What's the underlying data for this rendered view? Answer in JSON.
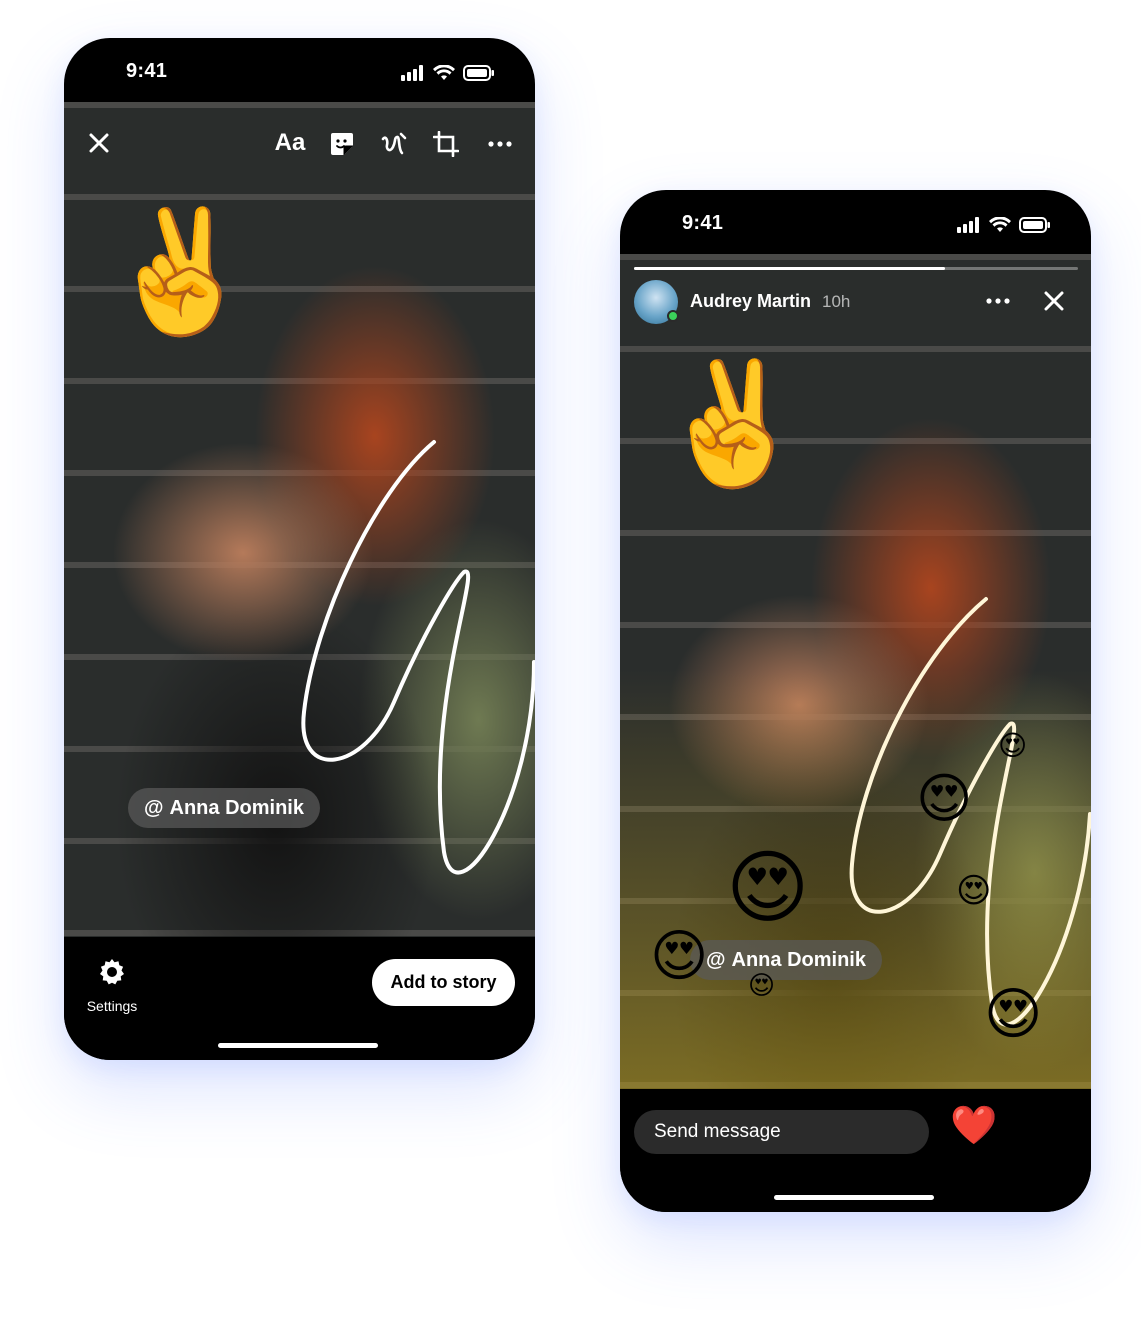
{
  "left_phone": {
    "status": {
      "time": "9:41"
    },
    "toolbar": {
      "close_icon": "close-icon",
      "text_label": "Aa",
      "sticker_icon": "sticker-icon",
      "draw_icon": "scribble-icon",
      "crop_icon": "crop-icon",
      "more_icon": "more-horizontal-icon"
    },
    "stickers": {
      "peace": "✌️"
    },
    "mention": {
      "at": "@",
      "name": "Anna Dominik"
    },
    "bottom": {
      "settings_label": "Settings",
      "add_button": "Add to story"
    }
  },
  "right_phone": {
    "status": {
      "time": "9:41"
    },
    "story_progress": 0.7,
    "header": {
      "username": "Audrey Martin",
      "time_ago": "10h",
      "more_icon": "more-horizontal-icon",
      "close_icon": "close-icon"
    },
    "stickers": {
      "peace": "✌️",
      "heart_eyes": "😍"
    },
    "mention": {
      "at": "@",
      "name": "Anna Dominik"
    },
    "reply": {
      "placeholder": "Send message"
    },
    "reactions": [
      "❤️",
      "😆",
      "😮"
    ]
  },
  "colors": {
    "background": "#ffffff",
    "phone": "#000000",
    "button_bg": "#ffffff",
    "online": "#3bd05a"
  }
}
